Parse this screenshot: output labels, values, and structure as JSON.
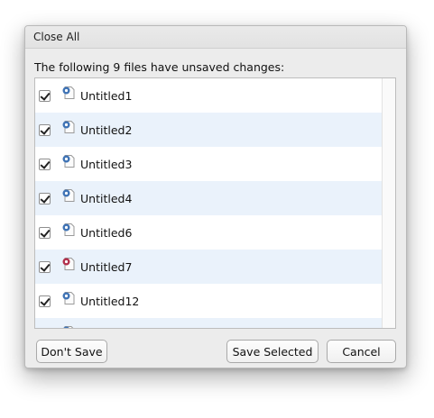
{
  "dialog": {
    "title": "Close All",
    "message": "The following 9 files have unsaved changes:"
  },
  "files": [
    {
      "name": "Untitled1",
      "checked": true,
      "icon": "r-script-icon"
    },
    {
      "name": "Untitled2",
      "checked": true,
      "icon": "r-script-icon"
    },
    {
      "name": "Untitled3",
      "checked": true,
      "icon": "r-script-icon"
    },
    {
      "name": "Untitled4",
      "checked": true,
      "icon": "r-script-icon"
    },
    {
      "name": "Untitled6",
      "checked": true,
      "icon": "r-script-icon"
    },
    {
      "name": "Untitled7",
      "checked": true,
      "icon": "r-markdown-icon"
    },
    {
      "name": "Untitled12",
      "checked": true,
      "icon": "r-script-icon"
    },
    {
      "name": "",
      "checked": true,
      "icon": "r-script-icon"
    }
  ],
  "buttons": {
    "dont_save": "Don't Save",
    "save_selected": "Save Selected",
    "cancel": "Cancel"
  },
  "colors": {
    "r_script_icon": "#3f73b5",
    "r_markdown_icon": "#b2304c",
    "row_alt": "#eaf2fb"
  }
}
